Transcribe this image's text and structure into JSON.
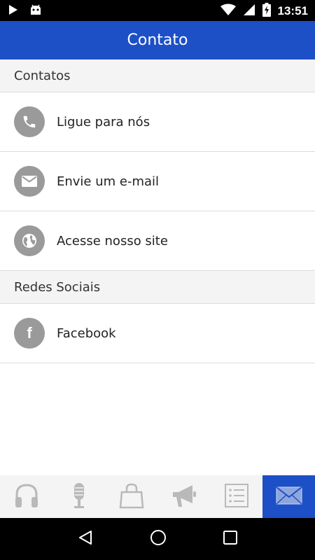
{
  "status_bar": {
    "time": "13:51",
    "icons": [
      "play-icon",
      "android-icon",
      "wifi-icon",
      "signal-icon",
      "battery-charging-icon"
    ]
  },
  "app_bar": {
    "title": "Contato"
  },
  "sections": [
    {
      "header": "Contatos",
      "items": [
        {
          "label": "Ligue para nós",
          "icon": "phone-icon"
        },
        {
          "label": "Envie um e-mail",
          "icon": "mail-icon"
        },
        {
          "label": "Acesse nosso site",
          "icon": "globe-icon"
        }
      ]
    },
    {
      "header": "Redes Sociais",
      "items": [
        {
          "label": "Facebook",
          "icon": "facebook-icon"
        }
      ]
    }
  ],
  "tab_bar": {
    "tabs": [
      {
        "icon": "headphones-icon",
        "active": false
      },
      {
        "icon": "microphone-icon",
        "active": false
      },
      {
        "icon": "shopping-bag-icon",
        "active": false
      },
      {
        "icon": "megaphone-icon",
        "active": false
      },
      {
        "icon": "list-icon",
        "active": false
      },
      {
        "icon": "envelope-icon",
        "active": true
      }
    ]
  },
  "nav_bar": {
    "buttons": [
      "back-icon",
      "home-icon",
      "recents-icon"
    ]
  },
  "colors": {
    "primary": "#1d4fc7",
    "icon_gray": "#9a9a9a",
    "section_bg": "#f4f4f4"
  }
}
